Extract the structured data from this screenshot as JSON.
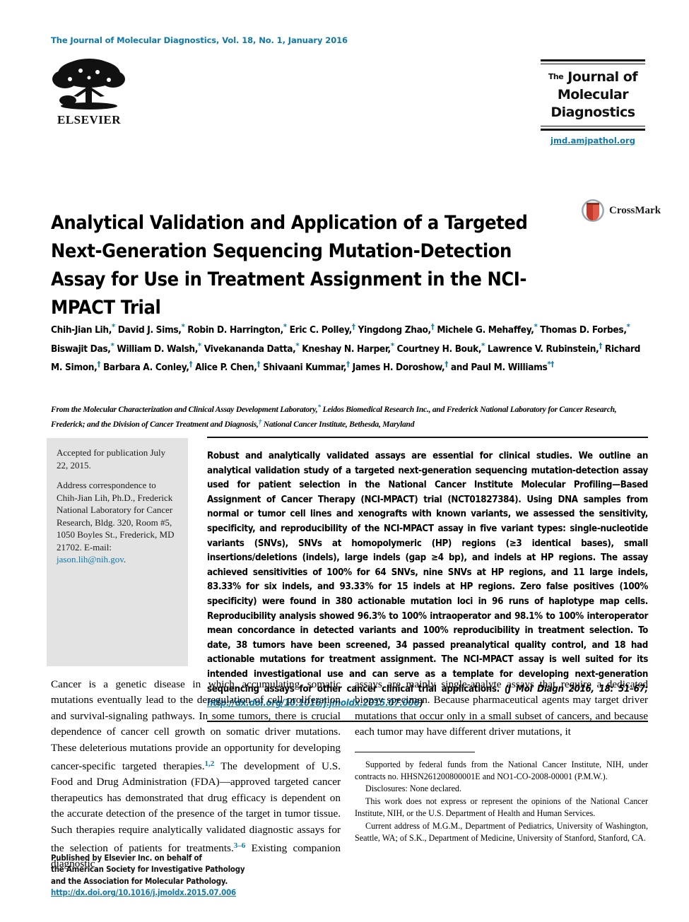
{
  "running_head": "The Journal of Molecular Diagnostics, Vol. 18, No. 1, January 2016",
  "accent_color": "#0e78a8",
  "publisher_logo": {
    "name": "ELSEVIER",
    "icon": "elsevier-tree-logo"
  },
  "journal_logo": {
    "the": "The",
    "line1": "Journal of",
    "line2": "Molecular",
    "line3": "Diagnostics",
    "url": "jmd.amjpathol.org"
  },
  "crossmark": {
    "label": "CrossMark"
  },
  "title": "Analytical Validation and Application of a Targeted Next-Generation Sequencing Mutation-Detection Assay for Use in Treatment Assignment in the NCI-MPACT Trial",
  "authors_html": "Chih-Jian Lih,<sup>*</sup> David J. Sims,<sup>*</sup> Robin D. Harrington,<sup>*</sup> Eric C. Polley,<sup>&#8224;</sup> Yingdong Zhao,<sup>&#8224;</sup> Michele G. Mehaffey,<sup>*</sup> Thomas D. Forbes,<sup>*</sup> Biswajit Das,<sup>*</sup> William D. Walsh,<sup>*</sup> Vivekananda Datta,<sup>*</sup> Kneshay N. Harper,<sup>*</sup> Courtney H. Bouk,<sup>*</sup> Lawrence V. Rubinstein,<sup>&#8224;</sup> Richard M. Simon,<sup>&#8224;</sup> Barbara A. Conley,<sup>&#8224;</sup> Alice P. Chen,<sup>&#8224;</sup> Shivaani Kummar,<sup>&#8224;</sup> James H. Doroshow,<sup>&#8224;</sup> and Paul M. Williams<sup>*&#8224;</sup>",
  "affiliation_html": "From the Molecular Characterization and Clinical Assay Development Laboratory,<sup>*</sup> Leidos Biomedical Research Inc., and Frederick National Laboratory for Cancer Research, Frederick; and the Division of Cancer Treatment and Diagnosis,<sup>&#8224;</sup> National Cancer Institute, Bethesda, Maryland",
  "sidebox": {
    "accepted": "Accepted for publication July 22, 2015.",
    "correspondence_html": "Address correspondence to Chih-Jian Lih, Ph.D., Frederick National Laboratory for Cancer Research, Bldg. 320, Room #5, 1050 Boyles St., Frederick, MD 21702. E-mail: <span class=\"link\">jason.lih@nih.gov</span>."
  },
  "abstract_html": "Robust and analytically validated assays are essential for clinical studies. We outline an analytical validation study of a targeted next-generation sequencing mutation-detection assay used for patient selection in the National Cancer Institute Molecular Profiling&#8212;Based Assignment of Cancer Therapy (NCI-MPACT) trial (NCT01827384). Using DNA samples from normal or tumor cell lines and xenografts with known variants, we assessed the sensitivity, specificity, and reproducibility of the NCI-MPACT assay in five variant types: single-nucleotide variants (SNVs), SNVs at homopolymeric (HP) regions (&#8805;3 identical bases), small insertions/deletions (indels), large indels (gap &#8805;4 bp), and indels at HP regions. The assay achieved sensitivities of 100% for 64 SNVs, nine SNVs at HP regions, and 11 large indels, 83.33% for six indels, and 93.33% for 15 indels at HP regions. Zero false positives (100% specificity) were found in 380 actionable mutation loci in 96 runs of haplotype map cells. Reproducibility analysis showed 96.3% to 100% intraoperator and 98.1% to 100% interoperator mean concordance in detected variants and 100% reproducibility in treatment selection. To date, 38 tumors have been screened, 34 passed preanalytical quality control, and 18 had actionable mutations for treatment assignment. The NCI-MPACT assay is well suited for its intended investigational use and can serve as a template for developing next-generation sequencing assays for other cancer clinical trial applications. <span class=\"cite\">(J Mol Diagn 2016, 18: 51&#8211;67; <span class=\"doi\">http://dx.doi.org/10.1016/j.jmoldx.2015.07.006</span>)</span>",
  "body_left_html": "Cancer is a genetic disease in which accumulating somatic mutations eventually lead to the deregulation of cell proliferation and survival-signaling pathways. In some tumors, there is crucial dependence of cancer cell growth on somatic driver mutations. These deleterious mutations provide an opportunity for developing cancer-specific targeted therapies.<sup>1,2</sup> The development of U.S. Food and Drug Administration (FDA)&#8212;approved targeted cancer therapeutics has demonstrated that drug efficacy is dependent on the accurate detection of the presence of the target in tumor tissue. Such therapies require analytically validated diagnostic assays for the selection of patients for treatments.<sup>3&#8211;6</sup> Existing companion diagnostic",
  "body_right_html": "assays are mainly single-analyte assays that require a dedicated biopsy specimen. Because pharmaceutical agents may target driver mutations that occur only in a small subset of cancers, and because each tumor may have different driver mutations, it",
  "footnotes": [
    "Supported by federal funds from the National Cancer Institute, NIH, under contracts no. HHSN261200800001E and NO1-CO-2008-00001 (P.M.W.).",
    "Disclosures: None declared.",
    "This work does not express or represent the opinions of the National Cancer Institute, NIH, or the U.S. Department of Health and Human Services.",
    "Current address of M.G.M., Department of Pediatrics, University of Washington, Seattle, WA; of S.K., Department of Medicine, University of Stanford, Stanford, CA."
  ],
  "footer": {
    "line1": "Published by Elsevier Inc. on behalf of",
    "line2": "the American Society for Investigative Pathology",
    "line3": "and the Association for Molecular Pathology.",
    "doi": "http://dx.doi.org/10.1016/j.jmoldx.2015.07.006"
  }
}
